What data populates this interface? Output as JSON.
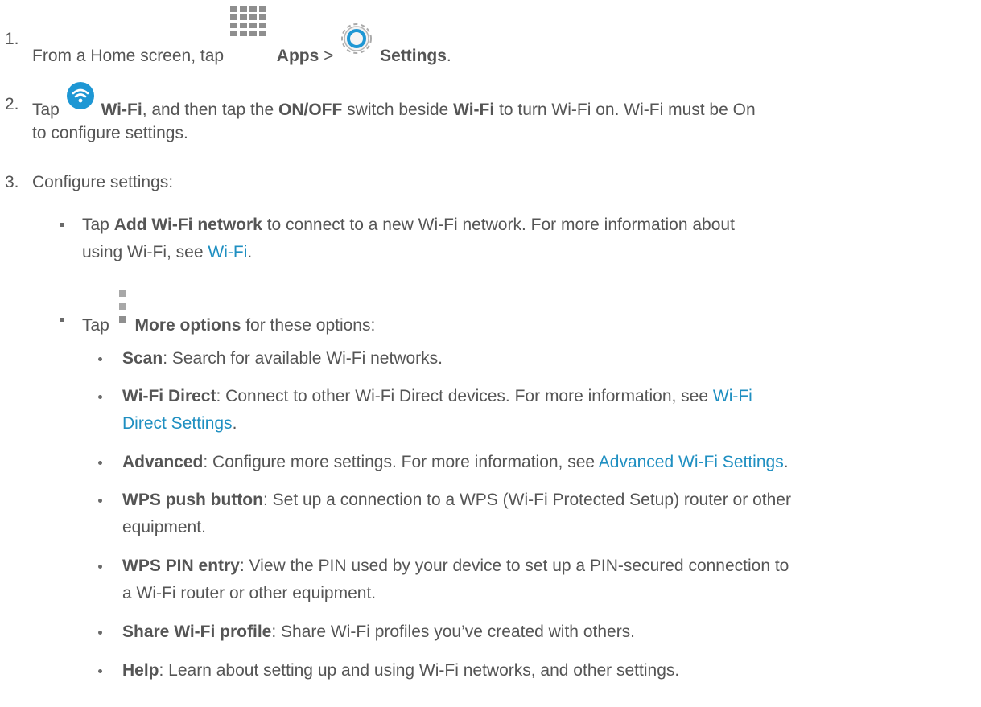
{
  "step1": {
    "number": "1.",
    "text_before": "From a Home screen, tap",
    "apps_label": "Apps",
    "separator": ">",
    "settings_label": "Settings",
    "end": "."
  },
  "step2": {
    "number": "2.",
    "tap": "Tap",
    "wifi_label": "Wi-Fi",
    "text_mid": ", and then tap the",
    "onoff_label": "ON/OFF",
    "text_mid2": "switch beside",
    "wifi_label2": "Wi-Fi",
    "text_end": "to turn Wi-Fi on. Wi-Fi must be On",
    "line2": "to configure settings."
  },
  "step3": {
    "number": "3.",
    "text": "Configure settings:"
  },
  "sub1": {
    "tap": "Tap",
    "add_label": "Add Wi-Fi network",
    "text": "to connect to a new Wi-Fi network. For more information about",
    "line2": "using Wi-Fi, see",
    "link": "Wi-Fi",
    "end": "."
  },
  "sub2": {
    "tap": "Tap",
    "more_label": "More options",
    "text": "for these options:"
  },
  "options": {
    "scan": {
      "label": "Scan",
      "text": ": Search for available Wi-Fi networks."
    },
    "direct": {
      "label": "Wi-Fi Direct",
      "text": ": Connect to other Wi-Fi Direct devices. For more information, see",
      "link1": "Wi-Fi",
      "link2": "Direct Settings",
      "end": "."
    },
    "advanced": {
      "label": "Advanced",
      "text": ": Configure more settings. For more information, see",
      "link": "Advanced Wi-Fi Settings",
      "end": "."
    },
    "wps_push": {
      "label": "WPS push button",
      "text": ": Set up a connection to a WPS (Wi-Fi Protected Setup) router or other",
      "line2": "equipment."
    },
    "wps_pin": {
      "label": "WPS PIN entry",
      "text": ": View the PIN used by your device to set up a PIN-secured connection to",
      "line2": "a Wi-Fi router or other equipment."
    },
    "share": {
      "label": "Share Wi-Fi profile",
      "text": ": Share Wi-Fi profiles you’ve created with others."
    },
    "help": {
      "label": "Help",
      "text": ": Learn about setting up and using Wi-Fi networks, and other settings."
    }
  },
  "icons": {
    "apps": "apps-grid-icon",
    "settings": "settings-gear-icon",
    "wifi": "wifi-icon",
    "more": "more-options-icon"
  },
  "colors": {
    "text": "#555555",
    "link": "#1f8fc1",
    "wifi_blue": "#1e97d4"
  }
}
